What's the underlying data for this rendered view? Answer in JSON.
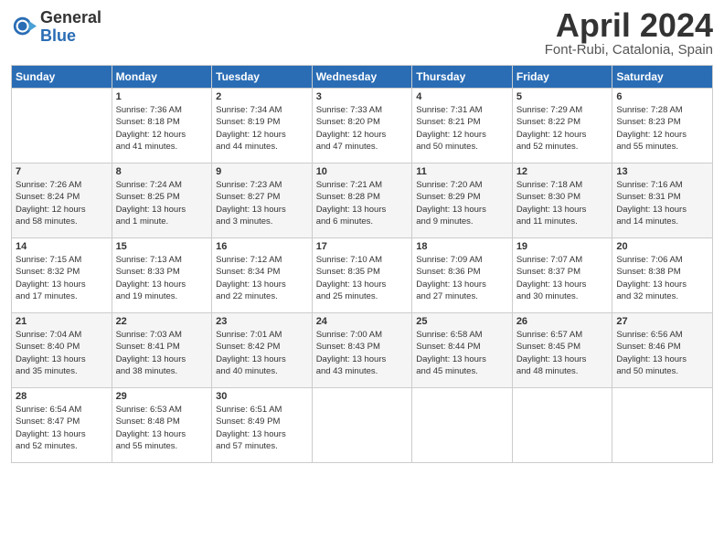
{
  "logo": {
    "general": "General",
    "blue": "Blue"
  },
  "title": "April 2024",
  "subtitle": "Font-Rubi, Catalonia, Spain",
  "days": [
    "Sunday",
    "Monday",
    "Tuesday",
    "Wednesday",
    "Thursday",
    "Friday",
    "Saturday"
  ],
  "weeks": [
    [
      {
        "num": "",
        "info": ""
      },
      {
        "num": "1",
        "info": "Sunrise: 7:36 AM\nSunset: 8:18 PM\nDaylight: 12 hours\nand 41 minutes."
      },
      {
        "num": "2",
        "info": "Sunrise: 7:34 AM\nSunset: 8:19 PM\nDaylight: 12 hours\nand 44 minutes."
      },
      {
        "num": "3",
        "info": "Sunrise: 7:33 AM\nSunset: 8:20 PM\nDaylight: 12 hours\nand 47 minutes."
      },
      {
        "num": "4",
        "info": "Sunrise: 7:31 AM\nSunset: 8:21 PM\nDaylight: 12 hours\nand 50 minutes."
      },
      {
        "num": "5",
        "info": "Sunrise: 7:29 AM\nSunset: 8:22 PM\nDaylight: 12 hours\nand 52 minutes."
      },
      {
        "num": "6",
        "info": "Sunrise: 7:28 AM\nSunset: 8:23 PM\nDaylight: 12 hours\nand 55 minutes."
      }
    ],
    [
      {
        "num": "7",
        "info": "Sunrise: 7:26 AM\nSunset: 8:24 PM\nDaylight: 12 hours\nand 58 minutes."
      },
      {
        "num": "8",
        "info": "Sunrise: 7:24 AM\nSunset: 8:25 PM\nDaylight: 13 hours\nand 1 minute."
      },
      {
        "num": "9",
        "info": "Sunrise: 7:23 AM\nSunset: 8:27 PM\nDaylight: 13 hours\nand 3 minutes."
      },
      {
        "num": "10",
        "info": "Sunrise: 7:21 AM\nSunset: 8:28 PM\nDaylight: 13 hours\nand 6 minutes."
      },
      {
        "num": "11",
        "info": "Sunrise: 7:20 AM\nSunset: 8:29 PM\nDaylight: 13 hours\nand 9 minutes."
      },
      {
        "num": "12",
        "info": "Sunrise: 7:18 AM\nSunset: 8:30 PM\nDaylight: 13 hours\nand 11 minutes."
      },
      {
        "num": "13",
        "info": "Sunrise: 7:16 AM\nSunset: 8:31 PM\nDaylight: 13 hours\nand 14 minutes."
      }
    ],
    [
      {
        "num": "14",
        "info": "Sunrise: 7:15 AM\nSunset: 8:32 PM\nDaylight: 13 hours\nand 17 minutes."
      },
      {
        "num": "15",
        "info": "Sunrise: 7:13 AM\nSunset: 8:33 PM\nDaylight: 13 hours\nand 19 minutes."
      },
      {
        "num": "16",
        "info": "Sunrise: 7:12 AM\nSunset: 8:34 PM\nDaylight: 13 hours\nand 22 minutes."
      },
      {
        "num": "17",
        "info": "Sunrise: 7:10 AM\nSunset: 8:35 PM\nDaylight: 13 hours\nand 25 minutes."
      },
      {
        "num": "18",
        "info": "Sunrise: 7:09 AM\nSunset: 8:36 PM\nDaylight: 13 hours\nand 27 minutes."
      },
      {
        "num": "19",
        "info": "Sunrise: 7:07 AM\nSunset: 8:37 PM\nDaylight: 13 hours\nand 30 minutes."
      },
      {
        "num": "20",
        "info": "Sunrise: 7:06 AM\nSunset: 8:38 PM\nDaylight: 13 hours\nand 32 minutes."
      }
    ],
    [
      {
        "num": "21",
        "info": "Sunrise: 7:04 AM\nSunset: 8:40 PM\nDaylight: 13 hours\nand 35 minutes."
      },
      {
        "num": "22",
        "info": "Sunrise: 7:03 AM\nSunset: 8:41 PM\nDaylight: 13 hours\nand 38 minutes."
      },
      {
        "num": "23",
        "info": "Sunrise: 7:01 AM\nSunset: 8:42 PM\nDaylight: 13 hours\nand 40 minutes."
      },
      {
        "num": "24",
        "info": "Sunrise: 7:00 AM\nSunset: 8:43 PM\nDaylight: 13 hours\nand 43 minutes."
      },
      {
        "num": "25",
        "info": "Sunrise: 6:58 AM\nSunset: 8:44 PM\nDaylight: 13 hours\nand 45 minutes."
      },
      {
        "num": "26",
        "info": "Sunrise: 6:57 AM\nSunset: 8:45 PM\nDaylight: 13 hours\nand 48 minutes."
      },
      {
        "num": "27",
        "info": "Sunrise: 6:56 AM\nSunset: 8:46 PM\nDaylight: 13 hours\nand 50 minutes."
      }
    ],
    [
      {
        "num": "28",
        "info": "Sunrise: 6:54 AM\nSunset: 8:47 PM\nDaylight: 13 hours\nand 52 minutes."
      },
      {
        "num": "29",
        "info": "Sunrise: 6:53 AM\nSunset: 8:48 PM\nDaylight: 13 hours\nand 55 minutes."
      },
      {
        "num": "30",
        "info": "Sunrise: 6:51 AM\nSunset: 8:49 PM\nDaylight: 13 hours\nand 57 minutes."
      },
      {
        "num": "",
        "info": ""
      },
      {
        "num": "",
        "info": ""
      },
      {
        "num": "",
        "info": ""
      },
      {
        "num": "",
        "info": ""
      }
    ]
  ]
}
